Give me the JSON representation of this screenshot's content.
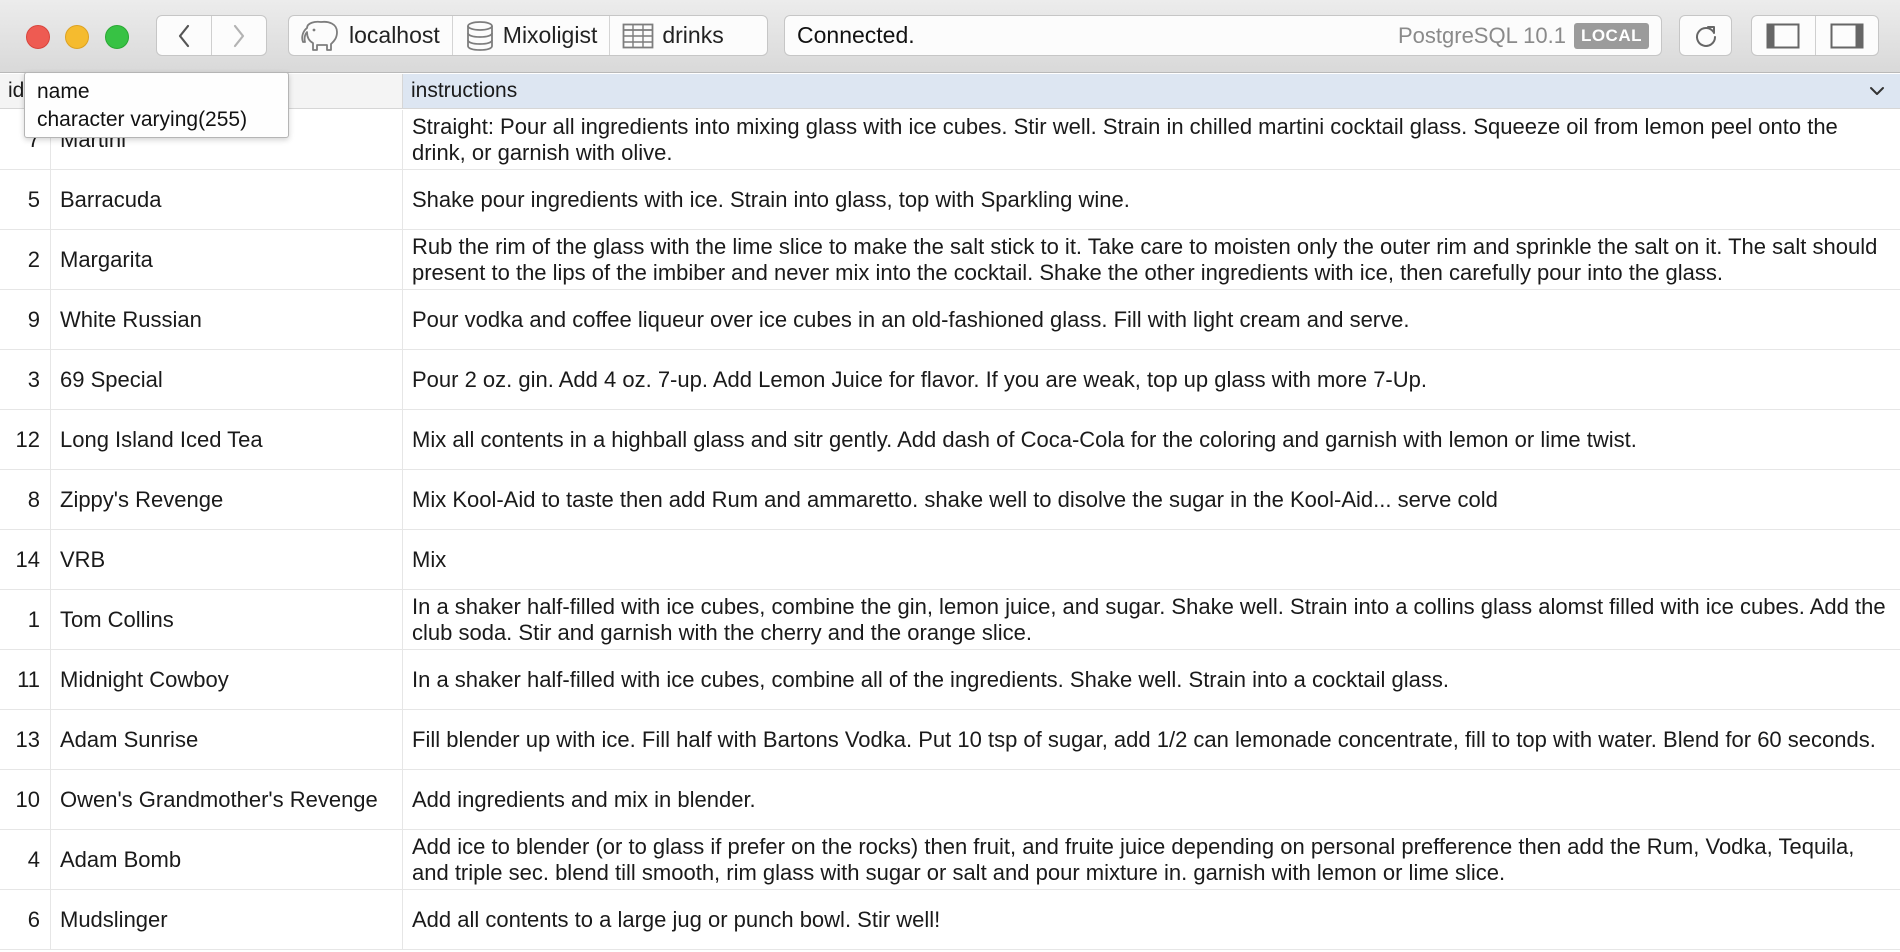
{
  "window": {
    "colors": {
      "close": "#ee5b52",
      "minimize": "#f5bb2f",
      "zoom": "#37c244"
    }
  },
  "breadcrumb": {
    "server": "localhost",
    "database": "Mixoligist",
    "table": "drinks"
  },
  "status": {
    "text": "Connected.",
    "server_version": "PostgreSQL 10.1",
    "badge": "LOCAL"
  },
  "table": {
    "columns": {
      "id": "id",
      "name": "name",
      "instructions": "instructions"
    },
    "rows": [
      {
        "id": "7",
        "name": "Martini",
        "instructions": "Straight: Pour all ingredients into mixing glass with ice cubes. Stir well. Strain in chilled martini cocktail glass. Squeeze oil from lemon peel onto the drink, or garnish with olive."
      },
      {
        "id": "5",
        "name": "Barracuda",
        "instructions": "Shake pour ingredients with ice. Strain into glass, top with Sparkling wine."
      },
      {
        "id": "2",
        "name": "Margarita",
        "instructions": "Rub the rim of the glass with the lime slice to make the salt stick to it. Take care to moisten only the outer rim and sprinkle the salt on it. The salt should present to the lips of the imbiber and never mix into the cocktail. Shake the other ingredients with ice, then carefully pour into the glass."
      },
      {
        "id": "9",
        "name": "White Russian",
        "instructions": "Pour vodka and coffee liqueur over ice cubes in an old-fashioned glass. Fill with light cream and serve."
      },
      {
        "id": "3",
        "name": "69 Special",
        "instructions": "Pour 2 oz. gin. Add 4 oz. 7-up. Add Lemon Juice for flavor. If you are weak, top up glass with more 7-Up."
      },
      {
        "id": "12",
        "name": "Long Island Iced Tea",
        "instructions": "Mix all contents in a highball glass and sitr gently. Add dash of Coca-Cola for the coloring and garnish with lemon or lime twist."
      },
      {
        "id": "8",
        "name": "Zippy's Revenge",
        "instructions": "Mix Kool-Aid to taste then add Rum and ammaretto. shake well to disolve the sugar in the Kool-Aid... serve cold"
      },
      {
        "id": "14",
        "name": "VRB",
        "instructions": "Mix"
      },
      {
        "id": "1",
        "name": "Tom Collins",
        "instructions": "In a shaker half-filled with ice cubes, combine the gin, lemon juice, and sugar. Shake well. Strain into a collins glass alomst filled with ice cubes. Add the club soda. Stir and garnish with the cherry and the orange slice."
      },
      {
        "id": "11",
        "name": "Midnight Cowboy",
        "instructions": "In a shaker half-filled with ice cubes, combine all of the ingredients. Shake well. Strain into a cocktail glass."
      },
      {
        "id": "13",
        "name": "Adam Sunrise",
        "instructions": "Fill blender up with ice. Fill half with Bartons Vodka. Put 10 tsp of sugar, add 1/2 can lemonade concentrate, fill to top with water. Blend for 60 seconds."
      },
      {
        "id": "10",
        "name": "Owen's Grandmother's Revenge",
        "instructions": "Add ingredients and mix in blender."
      },
      {
        "id": "4",
        "name": "Adam Bomb",
        "instructions": "Add ice to blender (or to glass if prefer on the rocks) then fruit, and fruite juice depending on personal prefference then add the Rum, Vodka, Tequila, and triple sec. blend till smooth, rim glass with sugar or salt and pour mixture in. garnish with lemon or lime slice."
      },
      {
        "id": "6",
        "name": "Mudslinger",
        "instructions": "Add all contents to a large jug or punch bowl. Stir well!"
      }
    ]
  },
  "tooltip": {
    "column_name": "name",
    "column_type": "character varying(255)"
  }
}
